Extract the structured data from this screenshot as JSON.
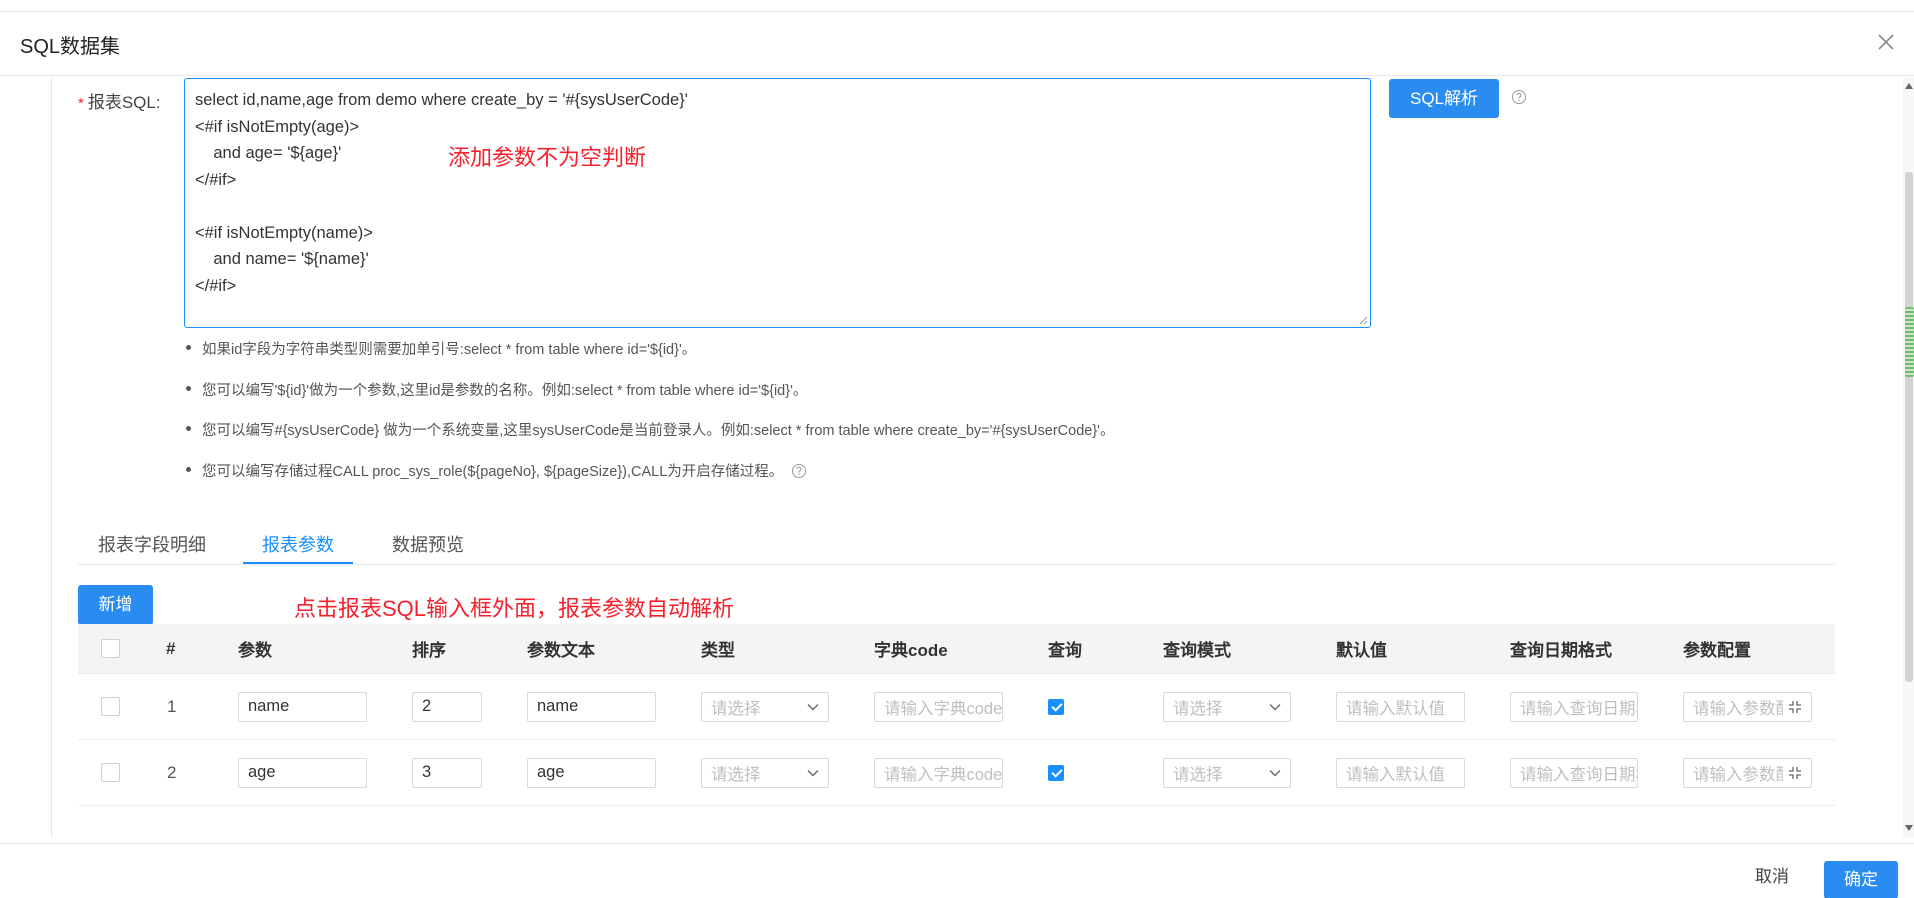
{
  "dialog": {
    "title": "SQL数据集"
  },
  "form": {
    "sql_label": "报表SQL:",
    "required_mark": "*",
    "sql_lines": [
      "select id,name,age from demo where create_by = '#{sysUserCode}'",
      "<#if isNotEmpty(age)>",
      "    and age= '${age}'",
      "</#if>",
      "",
      "<#if isNotEmpty(name)>",
      "    and name= '${name}'",
      "</#if>"
    ],
    "parse_button": "SQL解析"
  },
  "annotations": {
    "empty_check": "添加参数不为空判断",
    "auto_parse": "点击报表SQL输入框外面，报表参数自动解析"
  },
  "tips": [
    "如果id字段为字符串类型则需要加单引号:select * from table where id='${id}'。",
    "您可以编写'${id}'做为一个参数,这里id是参数的名称。例如:select * from table where id='${id}'。",
    "您可以编写#{sysUserCode} 做为一个系统变量,这里sysUserCode是当前登录人。例如:select * from table where create_by='#{sysUserCode}'。",
    "您可以编写存储过程CALL proc_sys_role(${pageNo}, ${pageSize}),CALL为开启存储过程。"
  ],
  "tabs": [
    {
      "label": "报表字段明细",
      "active": false
    },
    {
      "label": "报表参数",
      "active": true
    },
    {
      "label": "数据预览",
      "active": false
    }
  ],
  "add_button": "新增",
  "table": {
    "headers": [
      "#",
      "参数",
      "排序",
      "参数文本",
      "类型",
      "字典code",
      "查询",
      "查询模式",
      "默认值",
      "查询日期格式",
      "参数配置"
    ],
    "placeholders": {
      "type": "请选择",
      "dict_code": "请输入字典code",
      "query_mode": "请选择",
      "default_value": "请输入默认值",
      "date_format": "请输入查询日期格式",
      "param_config": "请输入参数配置"
    },
    "rows": [
      {
        "index": "1",
        "param": "name",
        "order": "2",
        "text": "name",
        "query": true
      },
      {
        "index": "2",
        "param": "age",
        "order": "3",
        "text": "age",
        "query": true
      }
    ]
  },
  "footer": {
    "cancel": "取消",
    "ok": "确定"
  },
  "colors": {
    "primary": "#2a8cf0",
    "annotation": "#f5222d",
    "active_tab": "#1890ff"
  }
}
